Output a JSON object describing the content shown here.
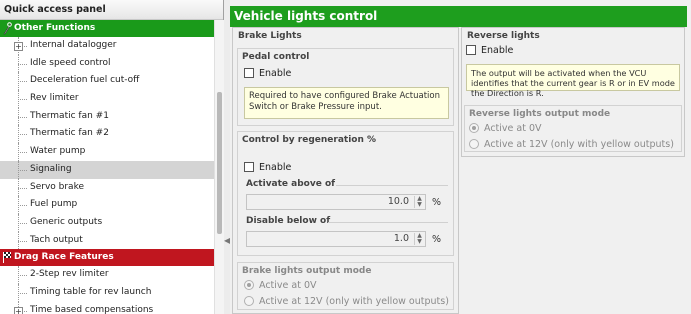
{
  "quick_access": {
    "title": "Quick access panel",
    "categories": {
      "other_functions": "Other Functions",
      "drag_race": "Drag Race Features"
    },
    "other_items": [
      "Internal datalogger",
      "Idle speed control",
      "Deceleration fuel cut-off",
      "Rev limiter",
      "Thermatic fan #1",
      "Thermatic fan #2",
      "Water pump",
      "Signaling",
      "Servo brake",
      "Fuel pump",
      "Generic outputs",
      "Tach output"
    ],
    "drag_items": [
      "2-Step rev limiter",
      "Timing table for rev launch",
      "Time based compensations"
    ],
    "selected": "Signaling",
    "expander_symbol": "+"
  },
  "main": {
    "title": "Vehicle lights control",
    "brake_lights": {
      "title": "Brake Lights",
      "pedal_control": {
        "title": "Pedal control",
        "enable_label": "Enable",
        "enabled": false,
        "note": "Required to have configured Brake Actuation Switch or Brake Pressure input."
      },
      "regen": {
        "title": "Control by regeneration %",
        "enable_label": "Enable",
        "enabled": false,
        "activate_label": "Activate above of",
        "activate_value": "10.0",
        "disable_label": "Disable below of",
        "disable_value": "1.0",
        "unit": "%"
      },
      "output_mode": {
        "title": "Brake lights output mode",
        "options": [
          "Active at 0V",
          "Active at 12V (only with yellow outputs)"
        ],
        "selected_index": 0
      }
    },
    "reverse_lights": {
      "title": "Reverse lights",
      "enable_label": "Enable",
      "enabled": false,
      "note": "The output will be activated when the VCU identifies that the current gear is R or in EV mode the Direction is R.",
      "output_mode": {
        "title": "Reverse lights output mode",
        "options": [
          "Active at 0V",
          "Active at 12V (only with yellow outputs)"
        ],
        "selected_index": 0
      }
    }
  },
  "icons": {
    "other_functions_icon": "wrench-icon",
    "drag_race_icon": "flag-icon",
    "spin_up": "▲",
    "spin_down": "▼",
    "splitter_grip": "◀"
  },
  "colors": {
    "green_accent": "#1e9e1e",
    "red_accent": "#c0161f",
    "note_bg": "#ffffe1"
  }
}
